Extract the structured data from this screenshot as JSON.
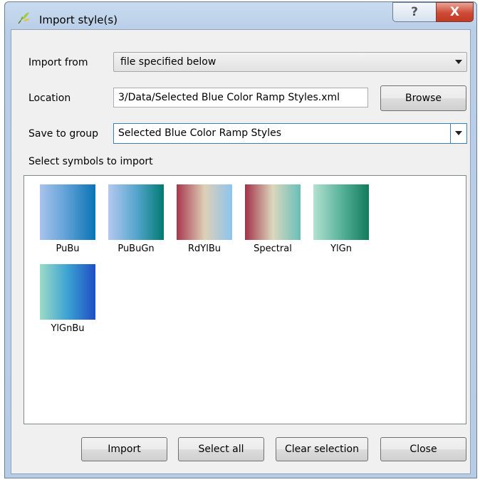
{
  "window": {
    "title": "Import style(s)",
    "help_glyph": "?",
    "close_glyph": "X",
    "icon": "qgis-logo-icon"
  },
  "form": {
    "import_from": {
      "label": "Import from",
      "value": "file specified below"
    },
    "location": {
      "label": "Location",
      "value": "3/Data/Selected Blue Color Ramp Styles.xml",
      "browse_label": "Browse"
    },
    "save_to_group": {
      "label": "Save to group",
      "value": "Selected Blue Color Ramp Styles"
    },
    "symbols_label": "Select symbols to import"
  },
  "symbols": [
    {
      "name": "PuBu",
      "colors": [
        "#a9c3ec",
        "#5b9fd6",
        "#0a73b4"
      ]
    },
    {
      "name": "PuBuGn",
      "colors": [
        "#b5c8f0",
        "#56a6cf",
        "#017a72"
      ]
    },
    {
      "name": "RdYlBu",
      "colors": [
        "#a8364d",
        "#ddd0b7",
        "#8dc4ee"
      ]
    },
    {
      "name": "Spectral",
      "colors": [
        "#a43248",
        "#dcd7bd",
        "#66bfb9"
      ]
    },
    {
      "name": "YlGn",
      "colors": [
        "#b4e2d0",
        "#58b39a",
        "#127a5c"
      ]
    },
    {
      "name": "YlGnBu",
      "colors": [
        "#9bdcc7",
        "#3ba2d2",
        "#1f4ec4"
      ]
    }
  ],
  "buttons": {
    "import": "Import",
    "select_all": "Select all",
    "clear_selection": "Clear selection",
    "close": "Close"
  }
}
